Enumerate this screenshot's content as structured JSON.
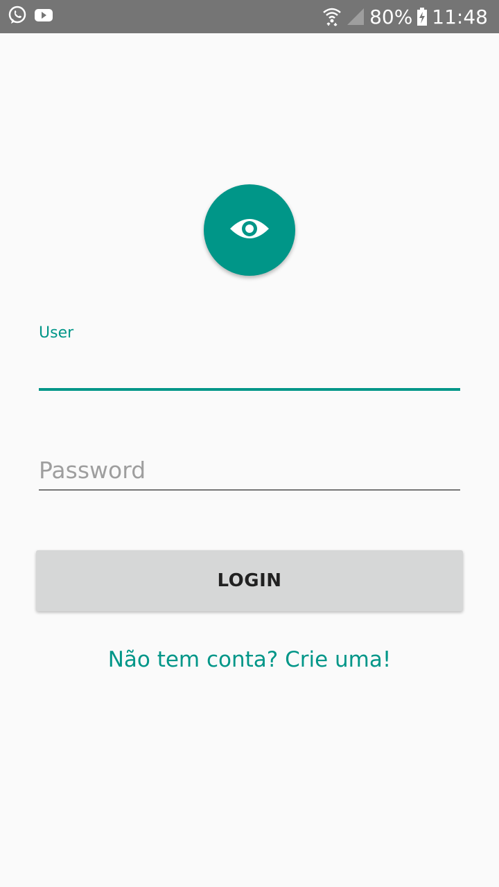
{
  "status_bar": {
    "battery": "80%",
    "time": "11:48",
    "icons": [
      "whatsapp-icon",
      "youtube-icon",
      "wifi-icon",
      "signal-icon",
      "battery-charging-icon"
    ]
  },
  "login": {
    "logo_icon": "eye-icon",
    "user_label": "User",
    "user_value": "",
    "password_placeholder": "Password",
    "password_value": "",
    "login_button": "LOGIN",
    "signup_link": "Não tem conta? Crie uma!"
  },
  "colors": {
    "accent": "#009688",
    "background": "#fafafa",
    "status_bar": "#757575",
    "button": "#d6d7d7"
  }
}
